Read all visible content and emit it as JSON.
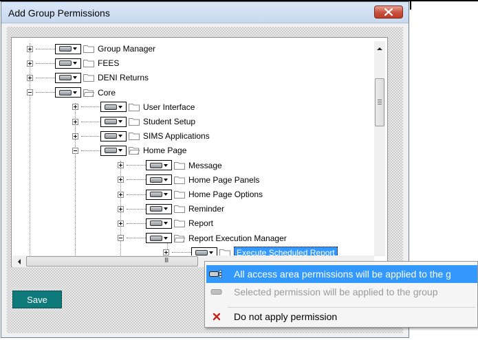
{
  "window": {
    "title": "Add Group Permissions"
  },
  "tree": {
    "items": [
      {
        "label": "Group Manager",
        "level": 0,
        "expanded": false
      },
      {
        "label": "FEES",
        "level": 0,
        "expanded": false
      },
      {
        "label": "DENI Returns",
        "level": 0,
        "expanded": false
      },
      {
        "label": "Core",
        "level": 0,
        "expanded": true
      },
      {
        "label": "User Interface",
        "level": 1,
        "expanded": false
      },
      {
        "label": "Student Setup",
        "level": 1,
        "expanded": false
      },
      {
        "label": "SIMS Applications",
        "level": 1,
        "expanded": false
      },
      {
        "label": "Home Page",
        "level": 1,
        "expanded": true
      },
      {
        "label": "Message",
        "level": 2,
        "expanded": false
      },
      {
        "label": "Home Page Panels",
        "level": 2,
        "expanded": false
      },
      {
        "label": "Home Page Options",
        "level": 2,
        "expanded": false
      },
      {
        "label": "Reminder",
        "level": 2,
        "expanded": false
      },
      {
        "label": "Report",
        "level": 2,
        "expanded": false
      },
      {
        "label": "Report Execution Manager",
        "level": 2,
        "expanded": true
      },
      {
        "label": "Execute Scheduled Report",
        "level": 3,
        "expanded": false,
        "selected": true
      }
    ]
  },
  "scrollbar": {
    "h_thumb_grip": "III"
  },
  "buttons": {
    "save": "Save"
  },
  "context_menu": {
    "items": [
      {
        "label": "All access area permissions will be applied to the g",
        "highlighted": true,
        "icon": "all-access-icon"
      },
      {
        "label": "Selected permission will be applied to the group",
        "disabled": true,
        "icon": "selected-permission-icon"
      },
      {
        "label": "Do not apply permission",
        "icon": "red-x-icon"
      }
    ]
  },
  "colors": {
    "selection": "#3399ff",
    "button_teal": "#0f7a7a",
    "close_red": "#c7503c"
  }
}
